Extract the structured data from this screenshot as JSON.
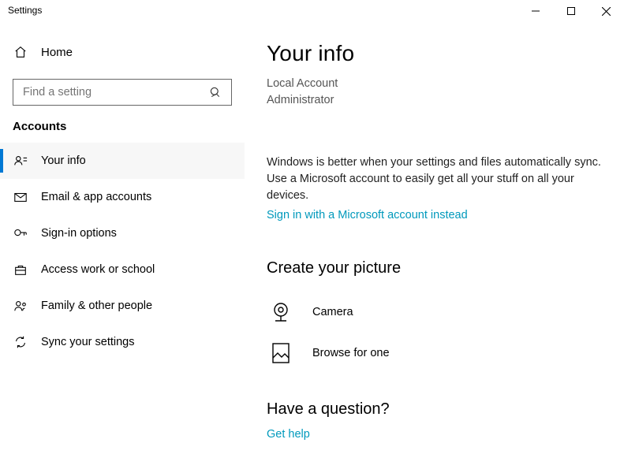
{
  "window": {
    "title": "Settings"
  },
  "sidebar": {
    "home": "Home",
    "search_placeholder": "Find a setting",
    "section": "Accounts",
    "items": [
      {
        "label": "Your info"
      },
      {
        "label": "Email & app accounts"
      },
      {
        "label": "Sign-in options"
      },
      {
        "label": "Access work or school"
      },
      {
        "label": "Family & other people"
      },
      {
        "label": "Sync your settings"
      }
    ]
  },
  "content": {
    "title": "Your info",
    "account_type": "Local Account",
    "role": "Administrator",
    "sync_blurb": "Windows is better when your settings and files automatically sync. Use a Microsoft account to easily get all your stuff on all your devices.",
    "signin_link": "Sign in with a Microsoft account instead",
    "picture_heading": "Create your picture",
    "camera": "Camera",
    "browse": "Browse for one",
    "question_heading": "Have a question?",
    "gethelp": "Get help"
  }
}
